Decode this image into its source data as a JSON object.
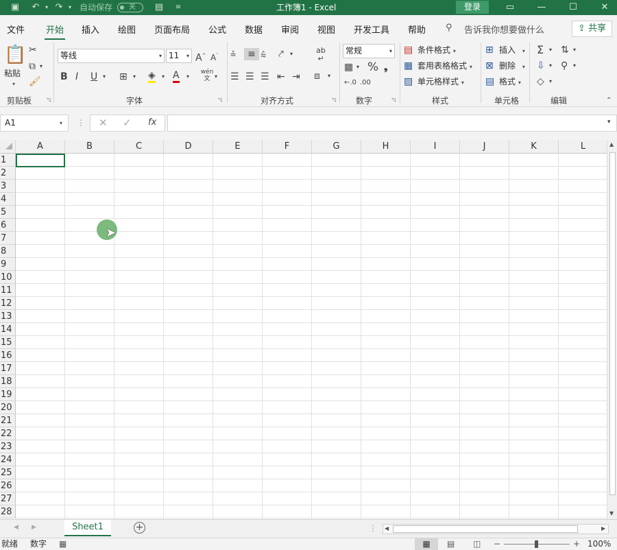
{
  "titlebar": {
    "autosave_label": "自动保存",
    "toggle_state": "关",
    "title": "工作簿1  -  Excel",
    "login_label": "登录"
  },
  "menu": {
    "tabs": [
      "文件",
      "开始",
      "插入",
      "绘图",
      "页面布局",
      "公式",
      "数据",
      "审阅",
      "视图",
      "开发工具",
      "帮助"
    ],
    "active_tab": "开始",
    "search_placeholder": "告诉我你想要做什么",
    "share_label": "共享"
  },
  "ribbon": {
    "clipboard": {
      "paste_label": "粘贴",
      "group_label": "剪贴板"
    },
    "font": {
      "font_name": "等线",
      "font_size": "11",
      "group_label": "字体",
      "phonetic_label": "wén"
    },
    "alignment": {
      "group_label": "对齐方式"
    },
    "number": {
      "format": "常规",
      "group_label": "数字"
    },
    "styles": {
      "conditional_format": "条件格式",
      "format_as_table": "套用表格格式",
      "cell_styles": "单元格样式",
      "group_label": "样式"
    },
    "cells": {
      "insert": "插入",
      "delete": "删除",
      "format": "格式",
      "group_label": "单元格"
    },
    "editing": {
      "group_label": "编辑"
    }
  },
  "formula_bar": {
    "name_box": "A1",
    "formula": ""
  },
  "grid": {
    "columns": [
      "A",
      "B",
      "C",
      "D",
      "E",
      "F",
      "G",
      "H",
      "I",
      "J",
      "K",
      "L"
    ],
    "rows": [
      "1",
      "2",
      "3",
      "4",
      "5",
      "6",
      "7",
      "8",
      "9",
      "10",
      "11",
      "12",
      "13",
      "14",
      "15",
      "16",
      "17",
      "18",
      "19",
      "20",
      "21",
      "22",
      "23",
      "24",
      "25",
      "26",
      "27",
      "28"
    ],
    "selected_cell": "A1"
  },
  "sheets": {
    "tabs": [
      "Sheet1"
    ],
    "active": "Sheet1"
  },
  "statusbar": {
    "ready": "就绪",
    "mode": "数字",
    "zoom": "100%"
  },
  "colors": {
    "accent": "#217346",
    "cursor_highlight": "#6fb36f"
  }
}
